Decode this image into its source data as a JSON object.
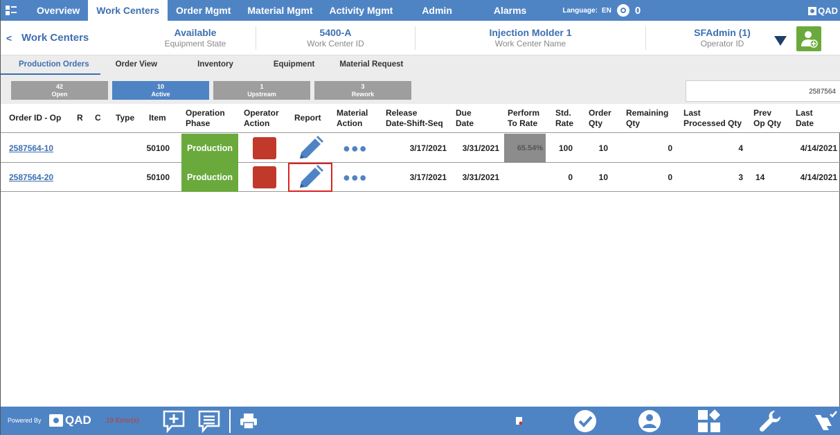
{
  "nav": {
    "items": [
      "Overview",
      "Work Centers",
      "Order Mgmt",
      "Material Mgmt",
      "Activity Mgmt",
      "Admin",
      "Alarms"
    ],
    "active": "Work Centers",
    "language_label": "Language:",
    "language_value": "EN",
    "alarm_count": "0",
    "brand": "QAD"
  },
  "info": {
    "back": "<",
    "work_centers_link": "Work Centers",
    "equipment_state": {
      "value": "Available",
      "label": "Equipment State"
    },
    "work_center_id": {
      "value": "5400-A",
      "label": "Work Center ID"
    },
    "work_center_name": {
      "value": "Injection Molder 1",
      "label": "Work Center Name"
    },
    "operator_id": {
      "value": "SFAdmin (1)",
      "label": "Operator ID"
    }
  },
  "subtabs": [
    "Production Orders",
    "Order View",
    "Inventory",
    "Equipment",
    "Material Request"
  ],
  "filters": [
    {
      "count": "42",
      "label": "Open"
    },
    {
      "count": "10",
      "label": "Active"
    },
    {
      "count": "1",
      "label": "Upstream"
    },
    {
      "count": "3",
      "label": "Rework"
    }
  ],
  "search_value": "2587564",
  "table": {
    "headers": [
      [
        "Order ID - Op"
      ],
      [
        "R"
      ],
      [
        "C"
      ],
      [
        "Type"
      ],
      [
        "Item"
      ],
      [
        "Operation",
        "Phase"
      ],
      [
        "Operator",
        "Action"
      ],
      [
        "Report"
      ],
      [
        "Material",
        "Action"
      ],
      [
        "Release",
        "Date-Shift-Seq"
      ],
      [
        "Due",
        "Date"
      ],
      [
        "Perform",
        "To Rate"
      ],
      [
        "Std.",
        "Rate"
      ],
      [
        "Order",
        "Qty"
      ],
      [
        "Remaining",
        "Qty"
      ],
      [
        "Last",
        "Processed Qty"
      ],
      [
        "Prev",
        "Op Qty"
      ],
      [
        "Last",
        "Date"
      ]
    ],
    "rows": [
      {
        "order": "2587564-10",
        "item": "50100",
        "phase": "Production",
        "dots": "●●●",
        "release": "3/17/2021",
        "due": "3/31/2021",
        "perf": "65.54%",
        "std_rate": "100",
        "order_qty": "10",
        "remaining": "0",
        "last_processed": "4",
        "prev_op": "",
        "last_date": "4/14/2021"
      },
      {
        "order": "2587564-20",
        "item": "50100",
        "phase": "Production",
        "dots": "●●●",
        "release": "3/17/2021",
        "due": "3/31/2021",
        "perf": "",
        "std_rate": "0",
        "order_qty": "10",
        "remaining": "0",
        "last_processed": "3",
        "prev_op": "14",
        "last_date": "4/14/2021"
      }
    ]
  },
  "footer": {
    "powered_by": "Powered By",
    "brand": "QAD",
    "errors": "19 Error(s)"
  },
  "colors": {
    "primary": "#4f84c4",
    "production": "#6aaa3d",
    "operator_action": "#c0392b",
    "highlight": "#d22222"
  }
}
